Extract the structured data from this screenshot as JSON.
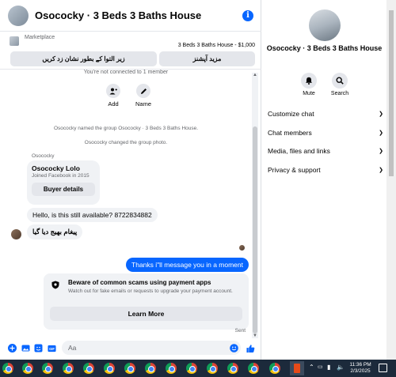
{
  "chat": {
    "title": "Osococky · 3 Beds 3 Baths House",
    "info_icon": "info-icon",
    "marketplace_label": "Marketplace",
    "marketplace_item": "3 Beds 3 Baths House - $1,000",
    "btn_more_options": "مزید آپشنز",
    "btn_mark_pending": "زیر التوا کے بطور نشان زد کریں",
    "not_connected": "You're not connected to 1 member",
    "actions": [
      {
        "label": "Add",
        "icon": "add-person-icon"
      },
      {
        "label": "Name",
        "icon": "pencil-icon"
      }
    ],
    "system_messages": [
      "Osococky named the group Osococky · 3 Beds 3 Baths House.",
      "Osococky changed the group photo."
    ],
    "sender_name": "Osococky",
    "profile_card": {
      "name": "Osococky Lolo",
      "joined": "Joined Facebook in 2015",
      "button": "Buyer details"
    },
    "incoming_messages": [
      "Hello, is this still available? 8722834882",
      "پیغام بھیج دیا گیا"
    ],
    "outgoing_message": "Thanks i\"ll message you in a moment",
    "scam_notice": {
      "title": "Beware of common scams using payment apps",
      "text": "Watch out for fake emails or requests to upgrade your payment account.",
      "button": "Learn More",
      "icon": "shield-icon"
    },
    "sent_label": "Sent",
    "composer": {
      "placeholder": "Aa",
      "icons": [
        "plus-icon",
        "photo-icon",
        "sticker-icon",
        "gif-icon",
        "emoji-icon",
        "thumbs-up-icon"
      ],
      "gif_label": "GIF"
    }
  },
  "details": {
    "title": "Osococky · 3 Beds 3 Baths House",
    "actions": [
      {
        "label": "Mute",
        "icon": "bell-icon"
      },
      {
        "label": "Search",
        "icon": "search-icon"
      }
    ],
    "sections": [
      "Customize chat",
      "Chat members",
      "Media, files and links",
      "Privacy & support"
    ]
  },
  "taskbar": {
    "time": "11:36 PM",
    "date": "2/3/2025",
    "app_icons": [
      "chrome-icon"
    ],
    "accent": "#0866ff"
  }
}
